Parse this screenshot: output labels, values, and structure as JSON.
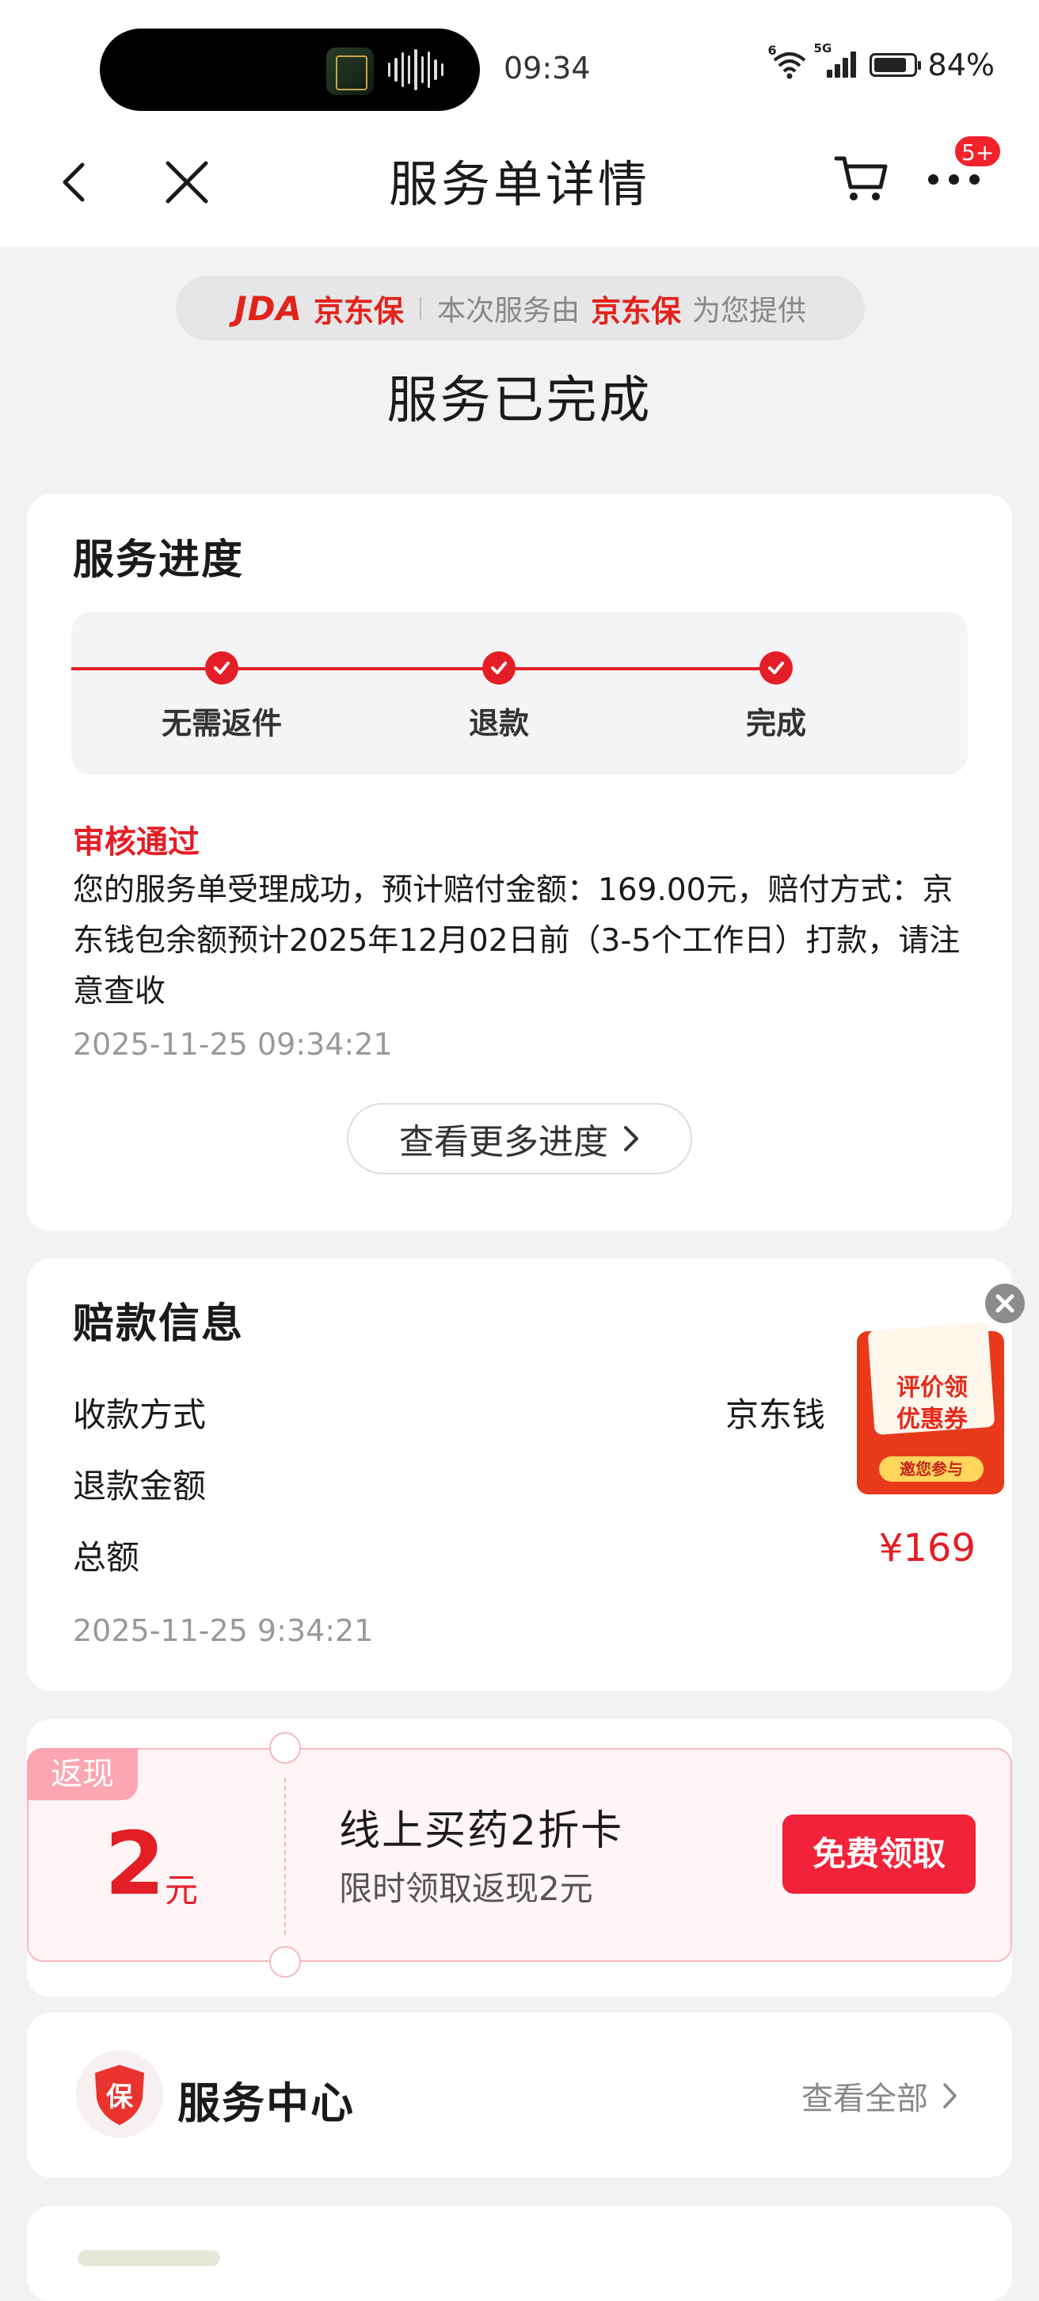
{
  "status_bar": {
    "time": "09:34",
    "battery": "84%"
  },
  "nav": {
    "title": "服务单详情",
    "badge": "5+"
  },
  "provider": {
    "brand": "JDA",
    "brand_name": "京东保",
    "text_prefix": "本次服务由",
    "text_brand": "京东保",
    "text_suffix": "为您提供"
  },
  "status_title": "服务已完成",
  "progress": {
    "title": "服务进度",
    "steps": [
      "无需返件",
      "退款",
      "完成"
    ],
    "review_status": "审核通过",
    "description": "您的服务单受理成功，预计赔付金额：169.00元，赔付方式：京东钱包余额预计2025年12月02日前（3-5个工作日）打款，请注意查收",
    "timestamp": "2025-11-25 09:34:21",
    "more_label": "查看更多进度"
  },
  "refund": {
    "title": "赔款信息",
    "rows": [
      {
        "label": "收款方式",
        "value": "京东钱"
      },
      {
        "label": "退款金额",
        "value": ""
      },
      {
        "label": "总额",
        "value": "¥169"
      }
    ],
    "timestamp": "2025-11-25 9:34:21"
  },
  "floating_coupon": {
    "line1": "评价领",
    "line2": "优惠券",
    "button": "邀您参与"
  },
  "promo": {
    "tag": "返现",
    "amount": "2",
    "unit": "元",
    "title": "线上买药2折卡",
    "subtitle": "限时领取返现2元",
    "button": "免费领取"
  },
  "service_center": {
    "icon_text": "保",
    "title": "服务中心",
    "link": "查看全部"
  },
  "colors": {
    "accent": "#e41e26",
    "button": "#f2223a",
    "background": "#f2f2f4"
  }
}
